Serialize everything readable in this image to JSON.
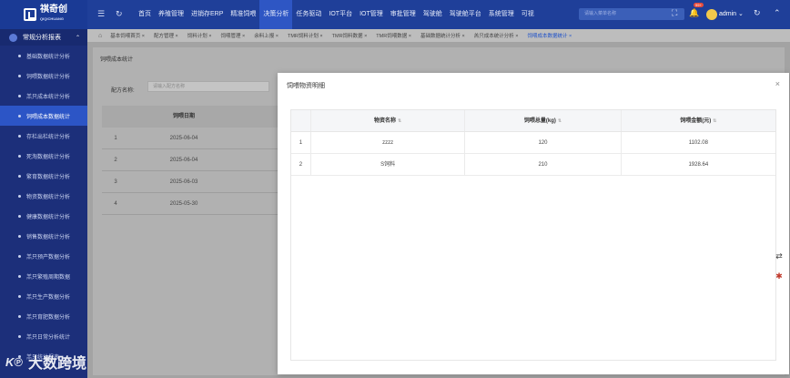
{
  "app": {
    "logo_text": "祺奇创",
    "logo_sub": "QIQICHUANG"
  },
  "topnav": {
    "items": [
      "首页",
      "养殖管理",
      "进销存ERP",
      "精准饲喂",
      "决策分析",
      "任务驱动",
      "IOT平台",
      "IOT管理",
      "审批管理",
      "驾驶舱",
      "驾驶舱平台",
      "系统管理",
      "可视"
    ],
    "active_index": 4,
    "search_placeholder": "请输入菜单名称",
    "badge_count": "99+",
    "user": "admin"
  },
  "sidebar": {
    "group_label": "常规分析报表",
    "items": [
      "基础数据统计分析",
      "饲喂数据统计分析",
      "羔只成本统计分析",
      "饲喂成本数据统计",
      "存栏出栏统计分析",
      "死淘数据统计分析",
      "繁育数据统计分析",
      "物资数据统计分析",
      "健康数据统计分析",
      "销售数据统计分析",
      "羔只预产数据分析",
      "羔只繁殖周期数据",
      "羔只生产数据分析",
      "羔只育肥数据分析",
      "羔只日常分析统计",
      "羔只统计报表"
    ],
    "active_index": 3,
    "watermark": "大数跨境"
  },
  "tabs": {
    "items": [
      "基本饲喂首页 ×",
      "配方管理 ×",
      "饲料计划 ×",
      "饲喂管理 ×",
      "余料上报 ×",
      "TMR饲料计划 ×",
      "TMR饲料数据 ×",
      "TMR饲喂数据 ×",
      "基础数据统计分析 ×",
      "羔只成本统计分析 ×",
      "饲喂成本数据统计 ×"
    ],
    "active_index": 10
  },
  "page": {
    "title": "饲喂成本统计",
    "filter_label": "配方名称:",
    "filter_placeholder": "请输入配方名称",
    "table_header_date": "饲喂日期",
    "rows": [
      {
        "idx": "1",
        "date": "2025-06-04"
      },
      {
        "idx": "2",
        "date": "2025-06-04"
      },
      {
        "idx": "3",
        "date": "2025-06-03"
      },
      {
        "idx": "4",
        "date": "2025-05-30"
      }
    ]
  },
  "modal": {
    "title": "饲喂物资明细",
    "close_icon": "close-icon",
    "headers": {
      "name": "物资名称",
      "weight": "饲喂总量(kg)",
      "amount": "饲喂金额(元)"
    },
    "rows": [
      {
        "idx": "1",
        "name": "zzzz",
        "weight": "120",
        "amount": "1102.08"
      },
      {
        "idx": "2",
        "name": "S饲料",
        "weight": "210",
        "amount": "1928.64"
      }
    ]
  },
  "colors": {
    "topbar": "#1f3f99",
    "sidebar": "#1c2f7a",
    "active": "#2c55c6"
  }
}
